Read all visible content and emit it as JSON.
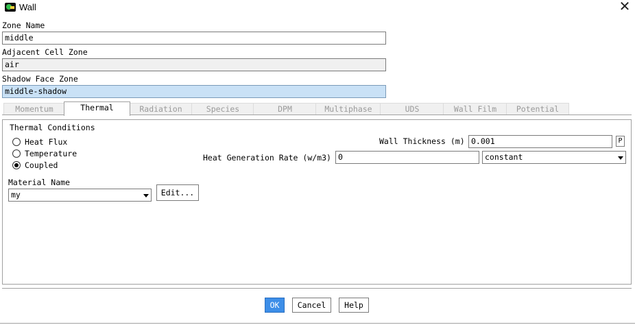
{
  "window": {
    "title": "Wall",
    "close_glyph": "✕",
    "icon": "fluent-app-icon"
  },
  "zone_name": {
    "label": "Zone Name",
    "value": "middle"
  },
  "adjacent_cell_zone": {
    "label": "Adjacent Cell Zone",
    "value": "air"
  },
  "shadow_face_zone": {
    "label": "Shadow Face Zone",
    "value": "middle-shadow"
  },
  "tabs": [
    {
      "label": "Momentum",
      "active": false
    },
    {
      "label": "Thermal",
      "active": true
    },
    {
      "label": "Radiation",
      "active": false
    },
    {
      "label": "Species",
      "active": false
    },
    {
      "label": "DPM",
      "active": false
    },
    {
      "label": "Multiphase",
      "active": false
    },
    {
      "label": "UDS",
      "active": false
    },
    {
      "label": "Wall Film",
      "active": false
    },
    {
      "label": "Potential",
      "active": false
    }
  ],
  "thermal": {
    "group_title": "Thermal Conditions",
    "conditions": [
      {
        "label": "Heat Flux",
        "selected": false
      },
      {
        "label": "Temperature",
        "selected": false
      },
      {
        "label": "Coupled",
        "selected": true
      }
    ],
    "wall_thickness": {
      "label": "Wall Thickness (m)",
      "value": "0.001",
      "param_button": "P"
    },
    "heat_generation": {
      "label": "Heat Generation Rate (w/m3)",
      "value": "0",
      "method": "constant"
    },
    "material": {
      "label": "Material Name",
      "value": "my",
      "edit_button": "Edit..."
    }
  },
  "buttons": {
    "ok": "OK",
    "cancel": "Cancel",
    "help": "Help"
  },
  "colors": {
    "ok_button_bg": "#3d8ee8",
    "selected_field_bg": "#c9e1f6"
  }
}
